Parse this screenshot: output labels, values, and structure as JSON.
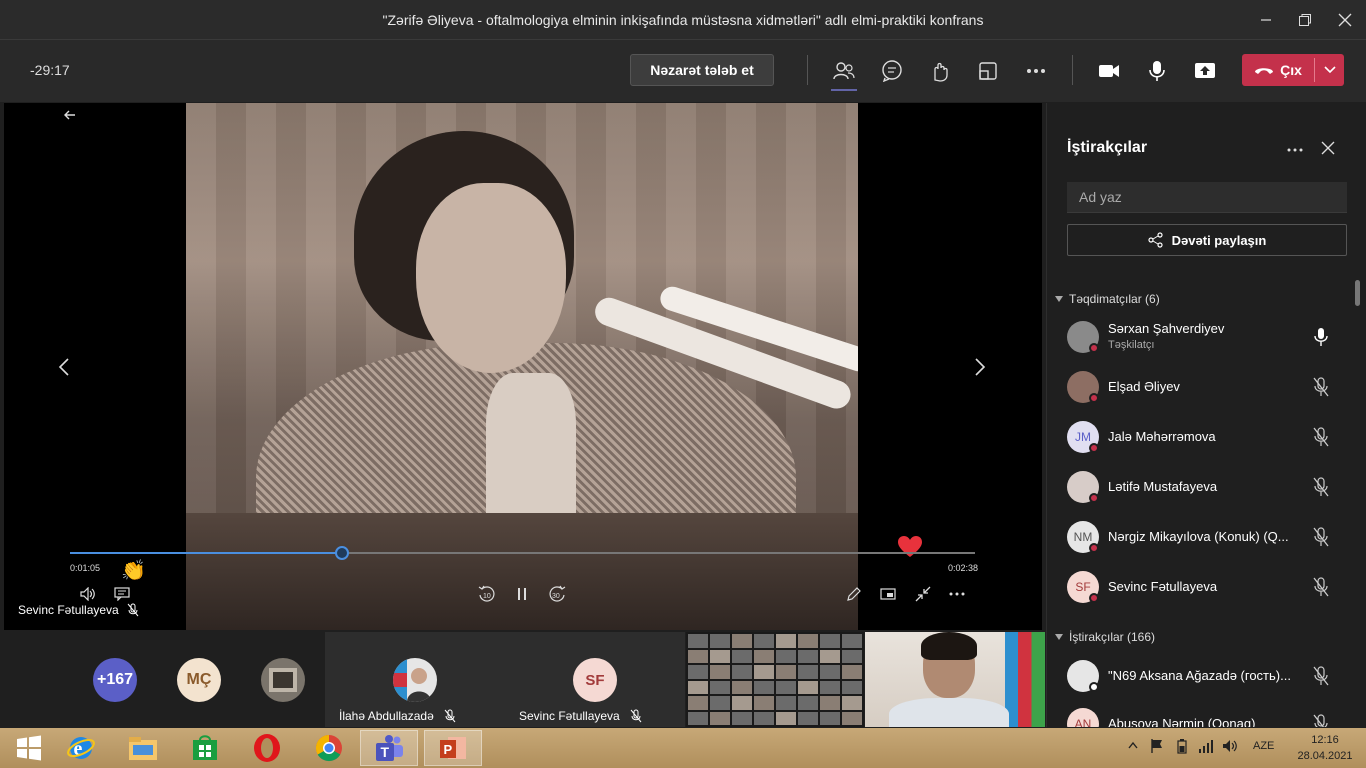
{
  "window": {
    "title": "\"Zərifə Əliyeva - oftalmologiya elminin inkişafında müstəsna xidmətləri\" adlı elmi-praktiki konfrans",
    "minimize_icon": "minimize-icon",
    "maximize_icon": "maximize-icon",
    "close_icon": "close-icon"
  },
  "toolbar": {
    "timer": "-29:17",
    "request_control_label": "Nəzarət tələb et",
    "leave_label": "Çıx",
    "icons": [
      "participants-icon",
      "chat-icon",
      "reactions-icon",
      "rooms-icon",
      "more-icon",
      "camera-icon",
      "mic-icon",
      "share-icon"
    ]
  },
  "stage": {
    "elapsed": "0:01:05",
    "duration": "0:02:38",
    "progress_fraction": 0.3,
    "presenter_name": "Sevinc Fətullayeva",
    "skip_back_label": "10",
    "skip_forward_label": "30"
  },
  "gallery": {
    "overflow_count": "+167",
    "initials_1": "MÇ",
    "tile_1_name": "İlahə Abdullazadə",
    "tile_2_initials": "SF",
    "tile_2_name": "Sevinc Fətullayeva"
  },
  "panel": {
    "title": "İştirakçılar",
    "search_placeholder": "Ad yaz",
    "share_label": "Dəvəti paylaşın",
    "presenters_header": "Təqdimatçılar (6)",
    "attendees_header": "İştirakçılar (166)",
    "presenters": [
      {
        "name": "Sərxan Şahverdiyev",
        "role": "Təşkilatçı",
        "initials": "",
        "mic": "on"
      },
      {
        "name": "Elşad Əliyev",
        "role": "",
        "initials": "",
        "mic": "off"
      },
      {
        "name": "Jalə Məhərrəmova",
        "role": "",
        "initials": "JM",
        "mic": "off"
      },
      {
        "name": "Lətifə Mustafayeva",
        "role": "",
        "initials": "",
        "mic": "off"
      },
      {
        "name": "Nərgiz Mikayılova (Konuk) (Q...",
        "role": "",
        "initials": "NM",
        "mic": "off"
      },
      {
        "name": "Sevinc Fətullayeva",
        "role": "",
        "initials": "SF",
        "mic": "off"
      }
    ],
    "attendees": [
      {
        "name": "\"N69 Aksana Ağazadə (гость)...",
        "initials": "",
        "mic": "off"
      },
      {
        "name": "Abuşova Nərmin (Qonaq)",
        "initials": "AN",
        "mic": "off"
      }
    ]
  },
  "taskbar": {
    "apps": [
      "windows-start-icon",
      "internet-explorer-icon",
      "file-explorer-icon",
      "store-icon",
      "opera-icon",
      "chrome-icon",
      "teams-icon",
      "powerpoint-icon"
    ],
    "language": "AZE",
    "time": "12:16",
    "date": "28.04.2021"
  },
  "colors": {
    "accent": "#6264a7",
    "leave": "#c4314b",
    "progress": "#4a8fe0",
    "status_busy": "#c4314b"
  }
}
